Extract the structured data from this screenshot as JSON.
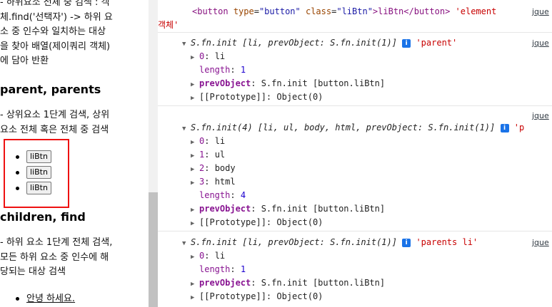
{
  "left": {
    "para1_lines": [
      "- 하위요소 전체 중 검색 : 객",
      "체.find('선택자') -> 하위 요",
      "소 중 인수와 일치하는 대상",
      "을 찾아 배열(제이쿼리 객체)",
      "에 담아 반환"
    ],
    "heading1": "parent, parents",
    "para2_lines": [
      "- 상위요소 1단계 검색, 상위",
      "요소 전체 혹은 전체 중 검색"
    ],
    "buttons": [
      "liBtn",
      "liBtn",
      "liBtn"
    ],
    "heading2": "children, find",
    "para3_lines": [
      "- 하위 요소 1단계 전체 검색,",
      "모든 하위 요소 중 인수에 해",
      "당되는 대상 검색"
    ],
    "list_item": "안녕 하세요."
  },
  "console": {
    "entry0": {
      "html_open": "<button",
      "attr1": "type",
      "val1": "\"button\"",
      "attr2": "class",
      "val2": "\"liBtn\"",
      "content": ">liBtn</",
      "html_close": "button>",
      "str_tail": "'element",
      "link": "jque",
      "wrap": "객체'"
    },
    "entry1": {
      "header": "S.fn.init [li, prevObject: S.fn.init(1)]",
      "info": "i",
      "label": "'parent'",
      "link": "jque",
      "k0": "0",
      "v0": "li",
      "len_key": "length",
      "len_val": "1",
      "prev_key": "prevObject",
      "prev_val": "S.fn.init [button.liBtn]",
      "proto": "[[Prototype]]: Object(0)"
    },
    "entry2": {
      "link": "jque",
      "header": "S.fn.init(4) [li, ul, body, html, prevObject: S.fn.init(1)]",
      "info": "i",
      "label": "'p",
      "items": [
        {
          "k": "0",
          "v": "li"
        },
        {
          "k": "1",
          "v": "ul"
        },
        {
          "k": "2",
          "v": "body"
        },
        {
          "k": "3",
          "v": "html"
        }
      ],
      "len_key": "length",
      "len_val": "4",
      "prev_key": "prevObject",
      "prev_val": "S.fn.init [button.liBtn]",
      "proto": "[[Prototype]]: Object(0)"
    },
    "entry3": {
      "header": "S.fn.init [li, prevObject: S.fn.init(1)]",
      "info": "i",
      "label": "'parents li'",
      "link": "jque",
      "k0": "0",
      "v0": "li",
      "len_key": "length",
      "len_val": "1",
      "prev_key": "prevObject",
      "prev_val": "S.fn.init [button.liBtn]",
      "proto": "[[Prototype]]: Object(0)"
    }
  }
}
